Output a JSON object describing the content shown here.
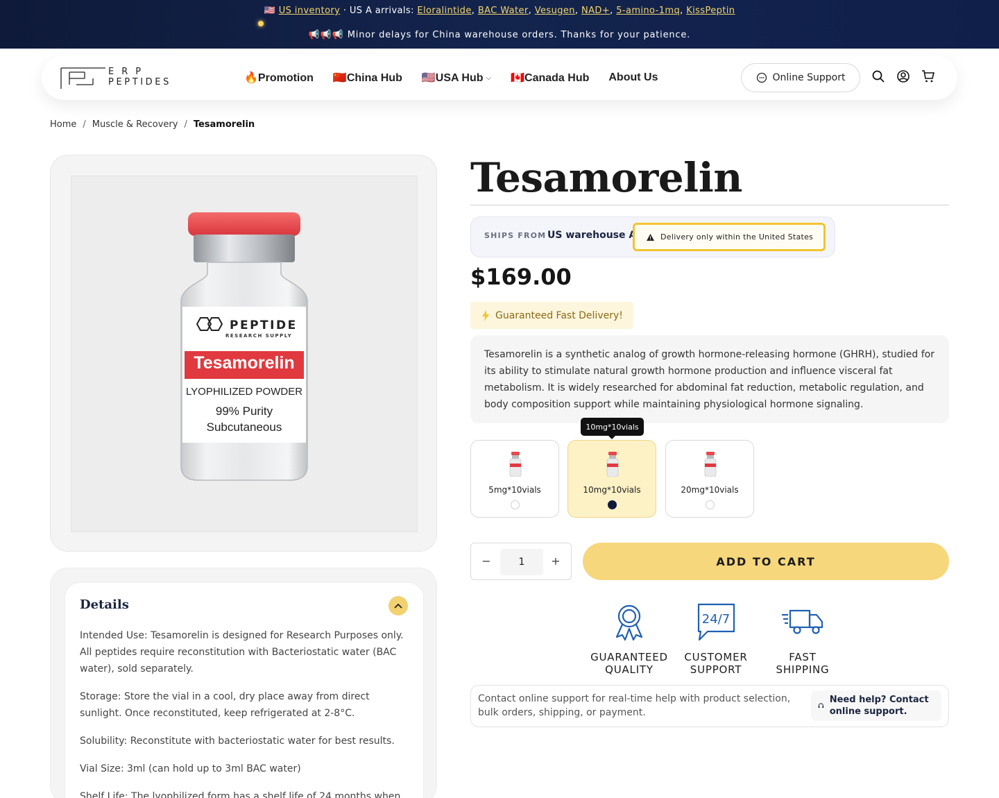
{
  "announcement": {
    "flag_us": "🇺🇸",
    "us_inventory_link": "US inventory",
    "separator": " · ",
    "arrivals_label": "US A arrivals:",
    "arrivals": [
      "Eloralintide",
      "BAC Water",
      "Vesugen",
      "NAD+",
      "5-amino-1mq",
      "KissPeptin"
    ],
    "delay_icons": "📢📢📢",
    "delay_text": "Minor delays for China warehouse orders. Thanks for your patience."
  },
  "header": {
    "logo_line1": "ERP",
    "logo_line2": "PEPTIDES",
    "nav": [
      {
        "label": "🔥Promotion"
      },
      {
        "label": "🇨🇳China Hub"
      },
      {
        "label": "🇺🇸USA Hub",
        "has_dropdown": true
      },
      {
        "label": "🇨🇦Canada Hub"
      },
      {
        "label": "About Us"
      }
    ],
    "support_label": "Online Support",
    "icons": [
      "search-icon",
      "account-icon",
      "cart-icon"
    ]
  },
  "breadcrumb": {
    "items": [
      "Home",
      "Muscle & Recovery",
      "Tesamorelin"
    ],
    "separator": "/"
  },
  "product_image": {
    "brand_name": "PEPTIDE",
    "brand_sub": "RESEARCH SUPPLY",
    "label_name": "Tesamorelin",
    "line1": "LYOPHILIZED POWDER",
    "line2": "99% Purity",
    "line3": "Subcutaneous"
  },
  "details": {
    "title": "Details",
    "paragraphs": [
      "Intended Use: Tesamorelin is designed for Research Purposes only. All peptides require reconstitution with Bacteriostatic water (BAC water), sold separately.",
      "Storage: Store the vial in a cool, dry place away from direct sunlight. Once reconstituted, keep refrigerated at 2-8°C.",
      "Solubility: Reconstitute with bacteriostatic water for best results.",
      "Vial Size: 3ml (can hold up to 3ml BAC water)",
      "Shelf Life: The lyophilized form has a shelf life of 24 months when"
    ]
  },
  "product": {
    "title": "Tesamorelin",
    "ships_from_label": "SHIPS FROM",
    "ships_from_value": "US warehouse A",
    "delivery_warning": "Delivery only within the United States",
    "price": "$169.00",
    "fast_delivery": "Guaranteed Fast Delivery!",
    "description": "Tesamorelin is a synthetic analog of growth hormone-releasing hormone (GHRH), studied for its ability to stimulate natural growth hormone production and influence visceral fat metabolism. It is widely researched for abdominal fat reduction, metabolic regulation, and body composition support while maintaining physiological hormone signaling.",
    "tooltip": "10mg*10vials",
    "variants": [
      {
        "label": "5mg*10vials",
        "selected": false
      },
      {
        "label": "10mg*10vials",
        "selected": true
      },
      {
        "label": "20mg*10vials",
        "selected": false
      }
    ],
    "quantity": "1",
    "qty_minus": "−",
    "qty_plus": "+",
    "add_to_cart": "ADD TO CART"
  },
  "features": [
    {
      "icon": "award-ribbon-icon",
      "line1": "GUARANTEED",
      "line2": "QUALITY"
    },
    {
      "icon": "support-247-icon",
      "line1": "CUSTOMER",
      "line2": "SUPPORT",
      "badge": "24/7"
    },
    {
      "icon": "delivery-truck-icon",
      "line1": "FAST",
      "line2": "SHIPPING"
    }
  ],
  "help": {
    "text": "Contact online support for real-time help with product selection, bulk orders, shipping, or payment.",
    "cta": "Need help? Contact online support."
  },
  "colors": {
    "announce_bg": "#13244d",
    "accent_yellow": "#f6d77c",
    "navy": "#1b2540",
    "link_yellow": "#f5d66b"
  }
}
